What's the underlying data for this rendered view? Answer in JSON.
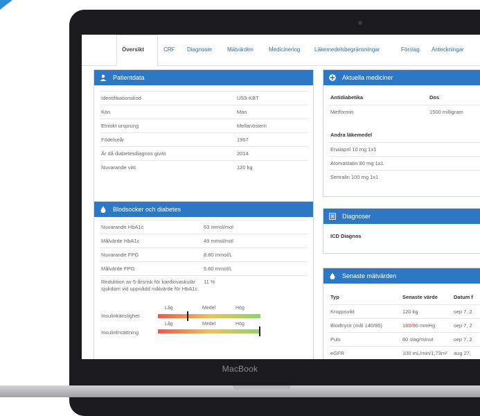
{
  "tabs": [
    "Översikt",
    "CRF",
    "Diagnoser",
    "Mätvärden",
    "Medicinering",
    "Läkemedelsbegränsningar",
    "Förslag",
    "Anteckningar"
  ],
  "patient": {
    "title": "Patientdata",
    "rows": [
      {
        "k": "Identifikationskod",
        "v": "US9-KBT"
      },
      {
        "k": "Kön",
        "v": "Man"
      },
      {
        "k": "Etniskt ursprung",
        "v": "Mellanöstern"
      },
      {
        "k": "Födelseår",
        "v": "1967"
      },
      {
        "k": "År då diabetesdiagnos givits",
        "v": "2014"
      },
      {
        "k": "Nuvarande vikt",
        "v": "120 kg"
      }
    ]
  },
  "glucose": {
    "title": "Blodsocker och diabetes",
    "rows": [
      {
        "k": "Nuvarande HbA1c",
        "v": "63 mmol/mol"
      },
      {
        "k": "Målvärde HbA1c",
        "v": "49 mmol/mol"
      },
      {
        "k": "Nuvarande FPG",
        "v": "8.80 mmol/L"
      },
      {
        "k": "Målvärde FPG",
        "v": "5.60 mmol/L"
      },
      {
        "k": "Reduktion av 5-årsrisk för kardiovaskulär sjukdom vid uppnådd målvärde för HbA1c",
        "v": "11 %"
      }
    ],
    "scale_low": "Låg",
    "scale_mid": "Medel",
    "scale_high": "Hög",
    "sensitivity_label": "Insulinkänslighet",
    "secretion_label": "Insulinfrisättning",
    "sensitivity_level": 0.29,
    "secretion_level": 1.0
  },
  "meds": {
    "title": "Aktuella mediciner",
    "h1": "Antidiabetika",
    "h_dose": "Dos",
    "row1": {
      "k": "Metformin",
      "v": "1500 milligram"
    },
    "h2": "Andra läkemedel",
    "others": [
      "Enalapril 10 mg 1x1",
      "Atorvastatin 80 mg 1x1",
      "Sertralin 100 mg 1x1"
    ]
  },
  "diagnoses": {
    "title": "Diagnoser",
    "h": "ICD Diagnos"
  },
  "latest": {
    "title": "Senaste mätvärden",
    "cols": [
      "Typ",
      "Senaste värde",
      "Datum f"
    ],
    "rows": [
      {
        "typ": "Kroppsvikt",
        "val": "120 kg",
        "date": "sep 7, 2"
      },
      {
        "typ": "Blodtryck (mål 140/85)",
        "val_red": "160/90",
        "val_rest": " mmHg",
        "date": "sep 7, 2"
      },
      {
        "typ": "Puls",
        "val": "80 slag/minut",
        "date": "sep 7, 2"
      },
      {
        "typ": "eGFR",
        "val": "100 mL/min/1,73m²",
        "date": "aug 27,"
      }
    ]
  },
  "device_brand": "MacBook",
  "colors": {
    "header": "#2d78c4",
    "red": "#d9322c",
    "link": "#2d6fa8"
  }
}
